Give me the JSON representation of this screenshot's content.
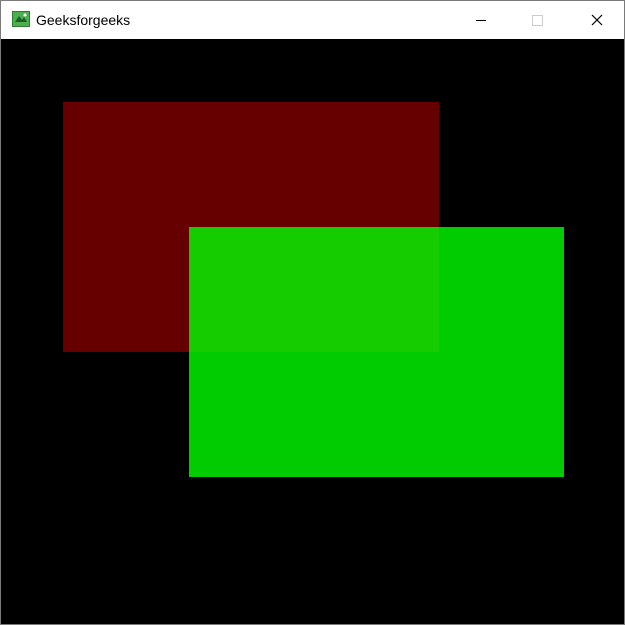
{
  "window": {
    "title": "Geeksforgeeks",
    "app_icon": "geeksforgeeks-app-icon",
    "controls": {
      "minimize_icon": "minimize-icon",
      "maximize_icon": "maximize-icon",
      "close_icon": "close-icon"
    }
  },
  "canvas": {
    "background_color": "#000000",
    "shapes": [
      {
        "name": "red-rectangle",
        "color": "#ff0000",
        "alpha": 0.4
      },
      {
        "name": "green-rectangle",
        "color": "#00ff00",
        "alpha": 0.8
      }
    ],
    "overlap_color": "#888a21"
  }
}
